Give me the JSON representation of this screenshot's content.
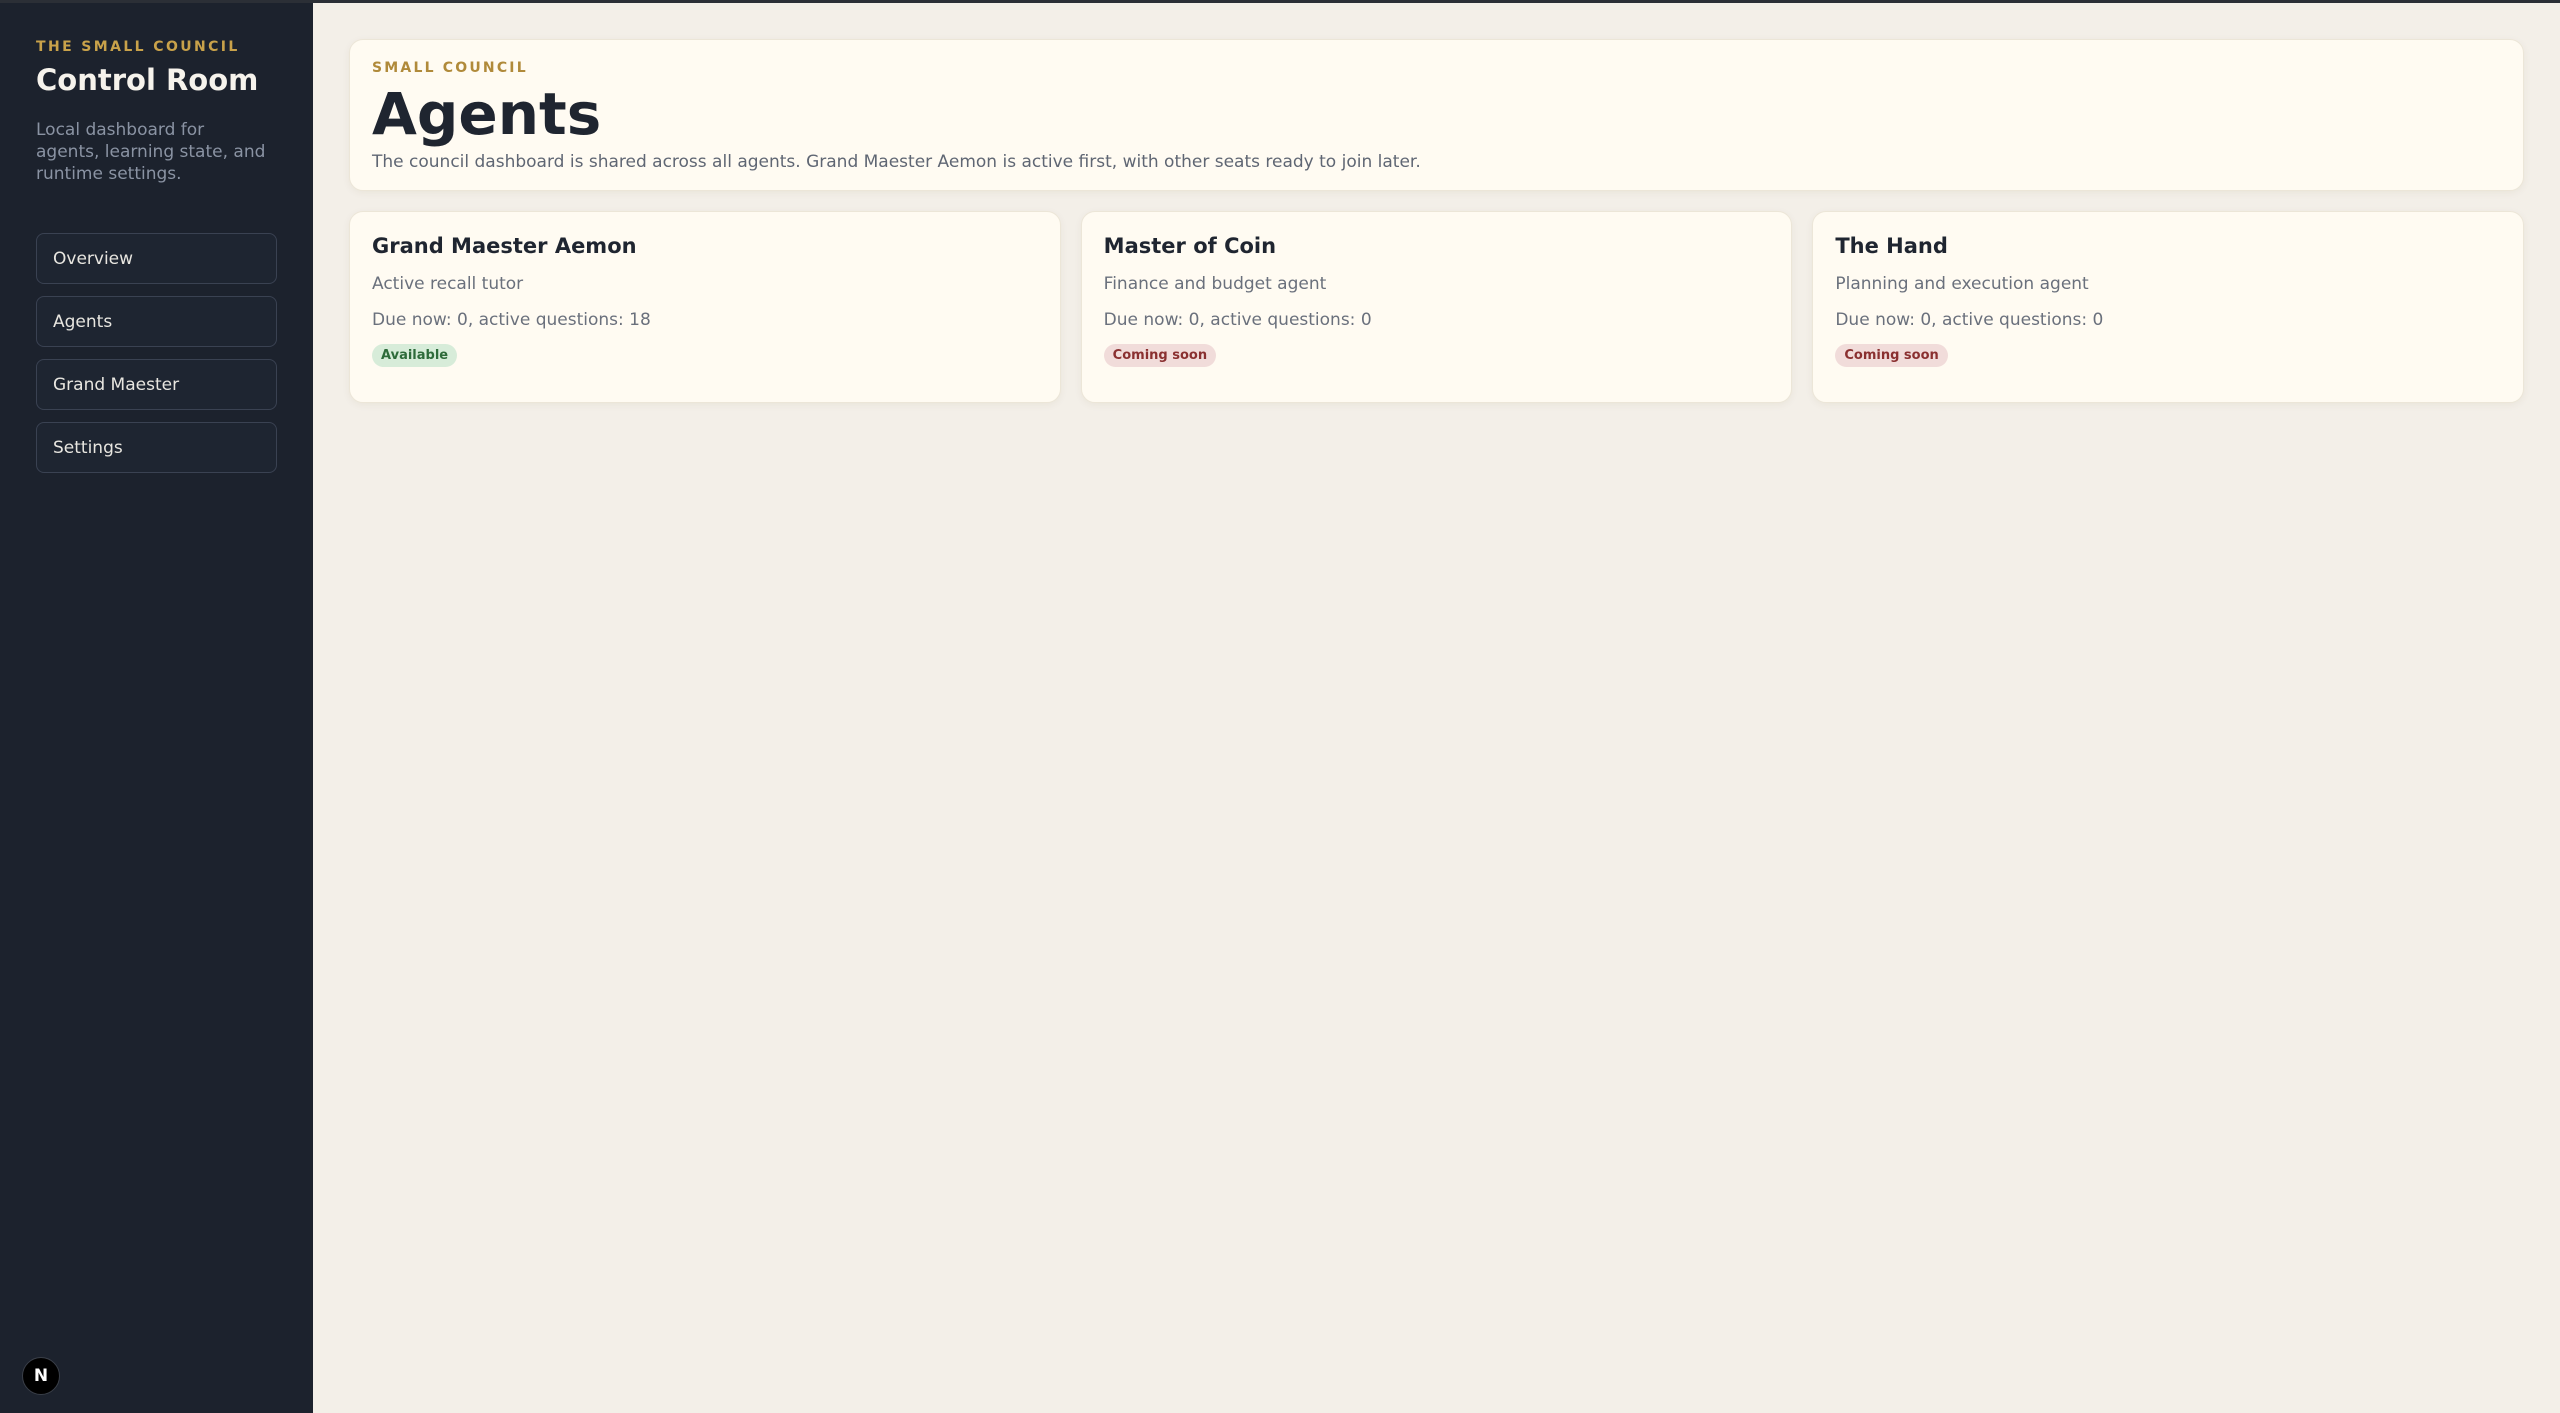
{
  "sidebar": {
    "eyebrow": "THE SMALL COUNCIL",
    "title": "Control Room",
    "description": "Local dashboard for agents, learning state, and runtime settings.",
    "nav": [
      {
        "label": "Overview"
      },
      {
        "label": "Agents"
      },
      {
        "label": "Grand Maester"
      },
      {
        "label": "Settings"
      }
    ],
    "footer_badge": "N"
  },
  "header": {
    "eyebrow": "SMALL COUNCIL",
    "title": "Agents",
    "description": "The council dashboard is shared across all agents. Grand Maester Aemon is active first, with other seats ready to join later."
  },
  "agents": [
    {
      "name": "Grand Maester Aemon",
      "role": "Active recall tutor",
      "stats": "Due now: 0, active questions: 18",
      "status": "Available",
      "status_color": "#2e6b3a"
    },
    {
      "name": "Master of Coin",
      "role": "Finance and budget agent",
      "stats": "Due now: 0, active questions: 0",
      "status": "Coming soon",
      "status_color": "#8a3030"
    },
    {
      "name": "The Hand",
      "role": "Planning and execution agent",
      "stats": "Due now: 0, active questions: 0",
      "status": "Coming soon",
      "status_color": "#8a3030"
    }
  ],
  "colors": {
    "sidebar_bg": "#1c222d",
    "page_bg": "#f3efe8",
    "card_bg": "#fffbf2",
    "accent_gold": "#c9a24a"
  }
}
